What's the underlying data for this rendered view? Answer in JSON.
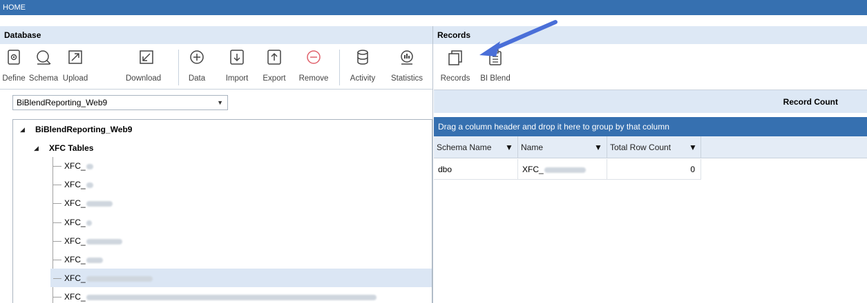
{
  "topbar": {
    "title": "HOME"
  },
  "database": {
    "title": "Database",
    "buttons": [
      {
        "label": "Define",
        "icon": "define-icon"
      },
      {
        "label": "Schema",
        "icon": "schema-icon"
      },
      {
        "label": "Upload",
        "icon": "upload-icon"
      },
      {
        "label": "Download",
        "icon": "download-icon"
      },
      {
        "label": "Data",
        "icon": "data-icon"
      },
      {
        "label": "Import",
        "icon": "import-icon"
      },
      {
        "label": "Export",
        "icon": "export-icon"
      },
      {
        "label": "Remove",
        "icon": "remove-icon"
      },
      {
        "label": "Activity",
        "icon": "activity-icon"
      },
      {
        "label": "Statistics",
        "icon": "statistics-icon"
      }
    ],
    "selected_database": "BiBlendReporting_Web9",
    "tree": {
      "root": "BiBlendReporting_Web9",
      "folder": "XFC Tables",
      "items": [
        "XFC_",
        "XFC_",
        "XFC_",
        "XFC_",
        "XFC_",
        "XFC_",
        "XFC_",
        "XFC_"
      ]
    }
  },
  "records": {
    "title": "Records",
    "buttons": [
      {
        "label": "Records",
        "icon": "records-icon"
      },
      {
        "label": "BI Blend",
        "icon": "bi-blend-icon"
      }
    ],
    "panel_title": "Record Count",
    "group_hint": "Drag a column header and drop it here to group by that column",
    "columns": [
      "Schema Name",
      "Name",
      "Total Row Count"
    ],
    "rows": [
      {
        "schema": "dbo",
        "name": "XFC_",
        "count": "0"
      }
    ]
  },
  "colors": {
    "accent": "#3670b0",
    "header_bg": "#dde8f5",
    "selection": "#dbe6f4",
    "annotation_arrow": "#4a6fd8"
  }
}
